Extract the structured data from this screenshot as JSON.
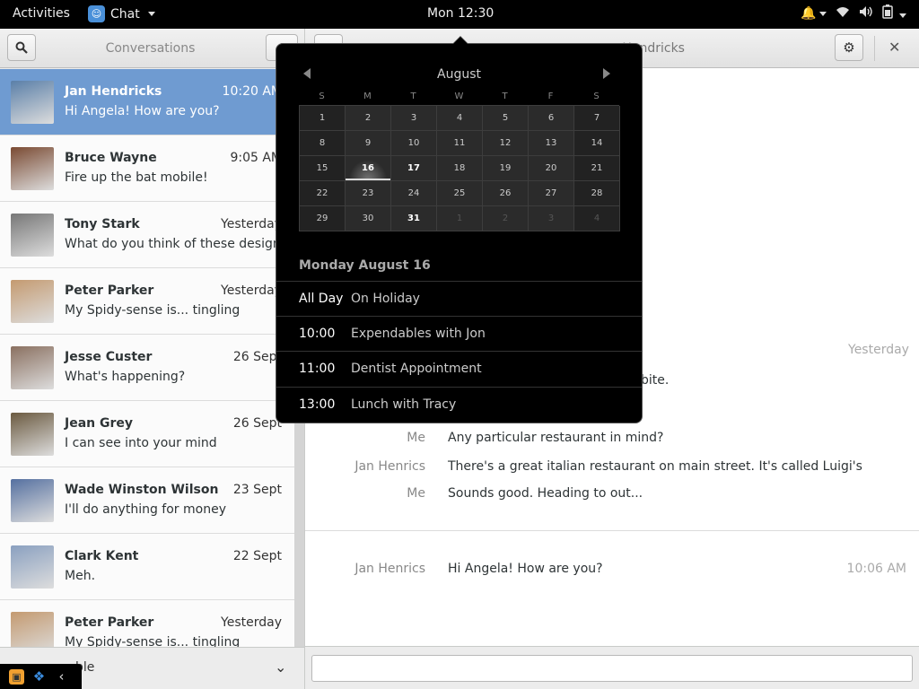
{
  "topbar": {
    "activities": "Activities",
    "app_name": "Chat",
    "clock": "Mon 12:30"
  },
  "left": {
    "title": "Conversations",
    "conversations": [
      {
        "name": "Jan Hendricks",
        "message": "Hi Angela! How are you?",
        "time": "10:20 AM",
        "selected": true
      },
      {
        "name": "Bruce Wayne",
        "message": "Fire up the bat mobile!",
        "time": "9:05 AM"
      },
      {
        "name": "Tony Stark",
        "message": "What do you think of these designs?",
        "time": "Yesterday"
      },
      {
        "name": "Peter Parker",
        "message": "My Spidy-sense is... tingling",
        "time": "Yesterday"
      },
      {
        "name": "Jesse Custer",
        "message": "What's happening?",
        "time": "26 Sept"
      },
      {
        "name": "Jean Grey",
        "message": "I can see into your mind",
        "time": "26 Sept"
      },
      {
        "name": "Wade Winston Wilson",
        "message": "I'll do anything for money",
        "time": "23 Sept"
      },
      {
        "name": "Clark Kent",
        "message": "Meh.",
        "time": "22 Sept"
      },
      {
        "name": "Peter Parker",
        "message": "My Spidy-sense is... tingling",
        "time": "Yesterday"
      }
    ],
    "presence": "ble"
  },
  "right": {
    "contact": "n Hendricks",
    "earlier_time": "Yesterday",
    "partial_message": "bite.",
    "messages": [
      {
        "who": "Me",
        "text": "Any particular restaurant in mind?"
      },
      {
        "who": "Jan Henrics",
        "text": "There's a great italian restaurant on main street. It's called Luigi's"
      },
      {
        "who": "Me",
        "text": "Sounds good. Heading to out..."
      }
    ],
    "latest": {
      "who": "Jan Henrics",
      "text": "Hi Angela! How are you?",
      "time": "10:06 AM"
    }
  },
  "calendar": {
    "month": "August",
    "weekdays": [
      "S",
      "M",
      "T",
      "W",
      "T",
      "F",
      "S"
    ],
    "weeks": [
      [
        "1",
        "2",
        "3",
        "4",
        "5",
        "6",
        "7"
      ],
      [
        "8",
        "9",
        "10",
        "11",
        "12",
        "13",
        "14"
      ],
      [
        "15",
        "16",
        "17",
        "18",
        "19",
        "20",
        "21"
      ],
      [
        "22",
        "23",
        "24",
        "25",
        "26",
        "27",
        "28"
      ],
      [
        "29",
        "30",
        "31",
        "1",
        "2",
        "3",
        "4"
      ]
    ],
    "today": "16",
    "event_days": [
      "17",
      "31"
    ],
    "day_title": "Monday August 16",
    "events": [
      {
        "time": "All Day",
        "title": "On Holiday"
      },
      {
        "time": "10:00",
        "title": "Expendables with Jon"
      },
      {
        "time": "11:00",
        "title": "Dentist Appointment"
      },
      {
        "time": "13:00",
        "title": "Lunch with Tracy"
      }
    ]
  }
}
